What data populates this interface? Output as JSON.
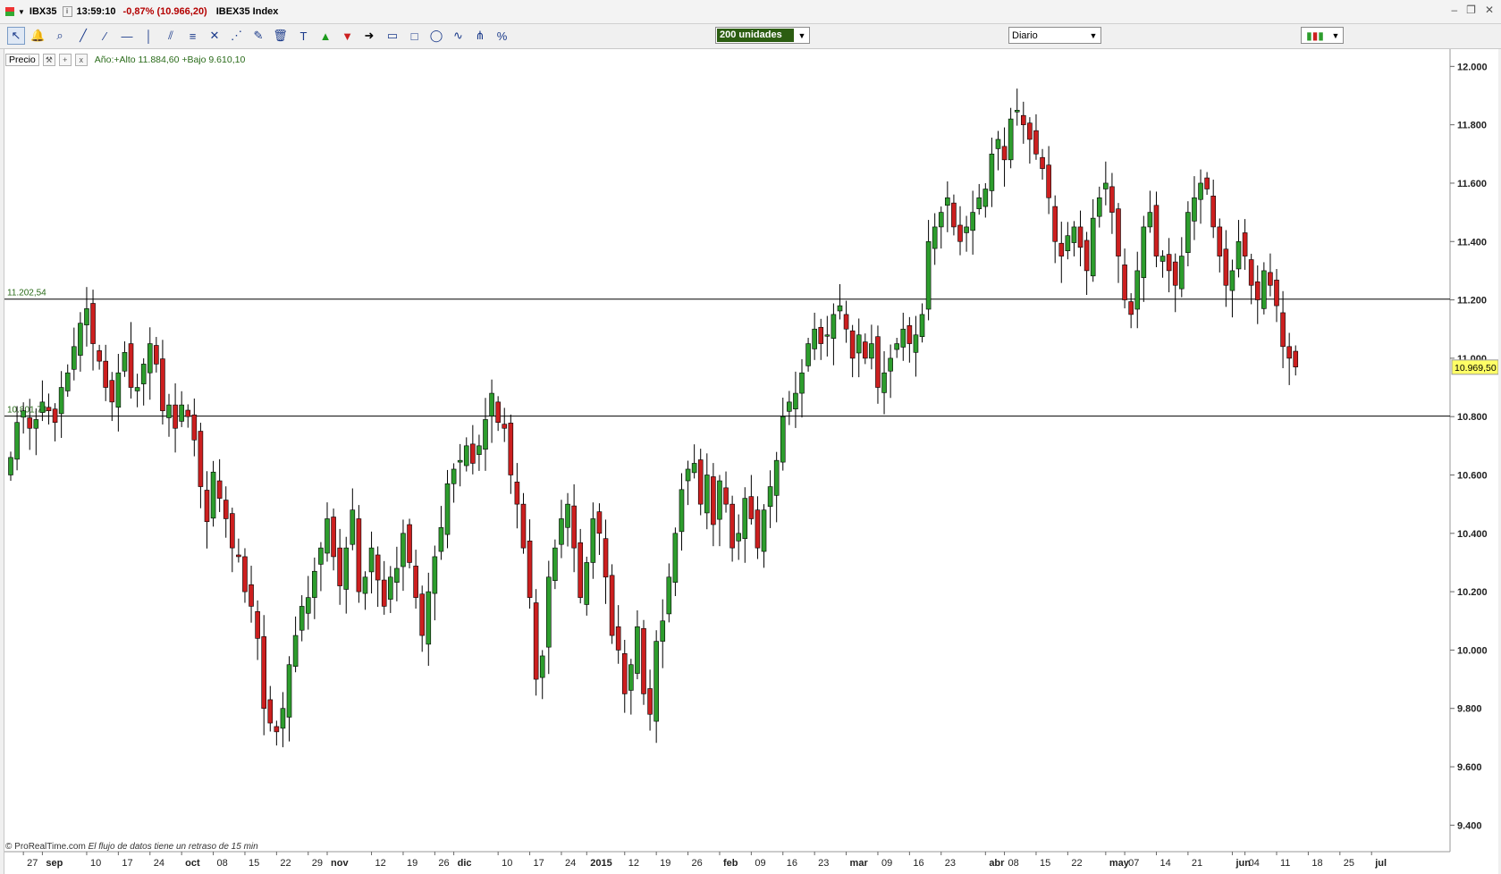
{
  "window": {
    "symbol": "IBX35",
    "time": "13:59:10",
    "change": "-0,87% (10.966,20)",
    "name": "IBEX35 Index"
  },
  "toolbar": {
    "tools": [
      "pointer-icon",
      "alarm-bell-icon",
      "zoom-icon",
      "trendline-icon",
      "ray-icon",
      "horizontal-line-icon",
      "vertical-line-icon",
      "parallel-channel-icon",
      "fibonacci-icon",
      "cross-icon",
      "fan-icon",
      "eraser-icon",
      "trash-icon",
      "text-icon",
      "buy-arrow-icon",
      "sell-arrow-icon",
      "arrow-right-icon",
      "ruler-icon",
      "rectangle-icon",
      "ellipse-icon",
      "zigzag-icon",
      "andrews-icon",
      "percent-icon"
    ],
    "units_value": "200 unidades",
    "period_value": "Diario"
  },
  "infobar": {
    "label": "Precio",
    "year_range": "Año:+Alto 11.884,60 +Bajo 9.610,10"
  },
  "footer": {
    "source": "© ProRealTime.com",
    "note": "El flujo de datos tiene un retraso de 15 min"
  },
  "colors": {
    "up": "#2d9d2d",
    "down": "#cc1f1f",
    "wick": "#000000",
    "last_price_bg": "#ffff66"
  },
  "chart_data": {
    "type": "candlestick",
    "ylim": [
      9300,
      12050
    ],
    "y_ticks": [
      9400,
      9600,
      9800,
      10000,
      10200,
      10400,
      10600,
      10800,
      11000,
      11200,
      11400,
      11600,
      11800,
      12000
    ],
    "y_tick_labels": [
      "9.400",
      "9.600",
      "9.800",
      "10.000",
      "10.200",
      "10.400",
      "10.600",
      "10.800",
      "11.000",
      "11.200",
      "11.400",
      "11.600",
      "11.800",
      "12.000"
    ],
    "x_labels": [
      {
        "label": "27",
        "bar": 2
      },
      {
        "label": "sep",
        "bar": 5
      },
      {
        "label": "10",
        "bar": 12
      },
      {
        "label": "17",
        "bar": 17
      },
      {
        "label": "24",
        "bar": 22
      },
      {
        "label": "oct",
        "bar": 27
      },
      {
        "label": "08",
        "bar": 32
      },
      {
        "label": "15",
        "bar": 37
      },
      {
        "label": "22",
        "bar": 42
      },
      {
        "label": "29",
        "bar": 47
      },
      {
        "label": "nov",
        "bar": 50
      },
      {
        "label": "12",
        "bar": 57
      },
      {
        "label": "19",
        "bar": 62
      },
      {
        "label": "26",
        "bar": 67
      },
      {
        "label": "dic",
        "bar": 70
      },
      {
        "label": "10",
        "bar": 77
      },
      {
        "label": "17",
        "bar": 82
      },
      {
        "label": "24",
        "bar": 87
      },
      {
        "label": "2015",
        "bar": 91
      },
      {
        "label": "12",
        "bar": 97
      },
      {
        "label": "19",
        "bar": 102
      },
      {
        "label": "26",
        "bar": 107
      },
      {
        "label": "feb",
        "bar": 112
      },
      {
        "label": "09",
        "bar": 117
      },
      {
        "label": "16",
        "bar": 122
      },
      {
        "label": "23",
        "bar": 127
      },
      {
        "label": "mar",
        "bar": 132
      },
      {
        "label": "09",
        "bar": 137
      },
      {
        "label": "16",
        "bar": 142
      },
      {
        "label": "23",
        "bar": 147
      },
      {
        "label": "abr",
        "bar": 154
      },
      {
        "label": "08",
        "bar": 157
      },
      {
        "label": "15",
        "bar": 162
      },
      {
        "label": "22",
        "bar": 167
      },
      {
        "label": "may",
        "bar": 173
      },
      {
        "label": "07",
        "bar": 176
      },
      {
        "label": "14",
        "bar": 181
      },
      {
        "label": "21",
        "bar": 186
      },
      {
        "label": "jun",
        "bar": 193
      },
      {
        "label": "04",
        "bar": 195
      },
      {
        "label": "11",
        "bar": 200
      },
      {
        "label": "18",
        "bar": 205
      },
      {
        "label": "25",
        "bar": 210
      },
      {
        "label": "jul",
        "bar": 215
      }
    ],
    "hlines": [
      {
        "value": 11202.54,
        "label": "11.202,54"
      },
      {
        "value": 10801.74,
        "label": "10.801,74"
      }
    ],
    "last_price": {
      "value": 10969.5,
      "label": "10.969,50"
    },
    "closes": [
      10660,
      10780,
      10820,
      10760,
      10790,
      10850,
      10820,
      10780,
      10900,
      10950,
      11040,
      11120,
      11170,
      11050,
      10990,
      10900,
      10850,
      10950,
      11020,
      10900,
      10900,
      10980,
      11050,
      10980,
      10820,
      10840,
      10760,
      10840,
      10800,
      10720,
      10560,
      10440,
      10610,
      10520,
      10450,
      10350,
      10320,
      10200,
      10150,
      10040,
      9800,
      9750,
      9720,
      9800,
      9950,
      10050,
      10150,
      10180,
      10270,
      10350,
      10450,
      10320,
      10220,
      10350,
      10480,
      10200,
      10250,
      10350,
      10240,
      10150,
      10250,
      10280,
      10400,
      10300,
      10180,
      10050,
      10200,
      10320,
      10420,
      10570,
      10620,
      10650,
      10700,
      10640,
      10700,
      10790,
      10880,
      10780,
      10760,
      10600,
      10500,
      10350,
      10180,
      9900,
      9980,
      10250,
      10350,
      10450,
      10500,
      10350,
      10180,
      10300,
      10450,
      10400,
      10250,
      10050,
      10000,
      9850,
      9950,
      10080,
      9850,
      9780,
      10030,
      10100,
      10250,
      10400,
      10550,
      10620,
      10640,
      10500,
      10600,
      10430,
      10580,
      10500,
      10350,
      10400,
      10520,
      10450,
      10350,
      10480,
      10560,
      10650,
      10800,
      10850,
      10880,
      10950,
      11050,
      11100,
      11050,
      11080,
      11150,
      11180,
      11100,
      11000,
      11080,
      11000,
      11050,
      10900,
      10950,
      11000,
      11050,
      11100,
      11050,
      11080,
      11150,
      11400,
      11450,
      11500,
      11550,
      11450,
      11400,
      11450,
      11500,
      11550,
      11580,
      11700,
      11750,
      11680,
      11820,
      11850,
      11800,
      11750,
      11700,
      11650,
      11550,
      11400,
      11350,
      11420,
      11450,
      11380,
      11300,
      11480,
      11550,
      11600,
      11500,
      11350,
      11200,
      11150,
      11300,
      11450,
      11500,
      11350,
      11350,
      11300,
      11250,
      11350,
      11500,
      11550,
      11600,
      11580,
      11450,
      11350,
      11250,
      11300,
      11400,
      11350,
      11250,
      11200,
      11300,
      11250,
      11180,
      11040,
      11000,
      10970
    ]
  }
}
